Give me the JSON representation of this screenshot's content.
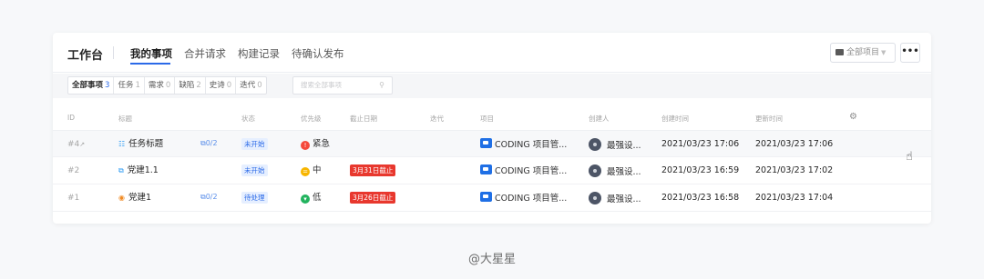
{
  "header": {
    "title": "工作台",
    "tabs": [
      {
        "label": "我的事项",
        "active": true
      },
      {
        "label": "合并请求",
        "active": false
      },
      {
        "label": "构建记录",
        "active": false
      },
      {
        "label": "待确认发布",
        "active": false
      }
    ],
    "project_select": "全部项目",
    "more": "•••"
  },
  "filters": [
    {
      "label": "全部事项",
      "count": "3",
      "active": true
    },
    {
      "label": "任务",
      "count": "1"
    },
    {
      "label": "需求",
      "count": "0"
    },
    {
      "label": "缺陷",
      "count": "2"
    },
    {
      "label": "史诗",
      "count": "0"
    },
    {
      "label": "迭代",
      "count": "0"
    }
  ],
  "search": {
    "placeholder": "搜索全部事项"
  },
  "columns": [
    "ID",
    "标题",
    "状态",
    "优先级",
    "截止日期",
    "迭代",
    "项目",
    "创建人",
    "创建时间",
    "更新时间"
  ],
  "rows": [
    {
      "id": "#4",
      "type_icon": "task-icon",
      "title": "任务标题",
      "sub": "0/2",
      "status": "未开始",
      "priority": "紧急",
      "priority_color": "#f5483b",
      "deadline": "",
      "project": "CODING 项目管...",
      "creator": "最强设...",
      "created": "2021/03/23 17:06",
      "updated": "2021/03/23 17:06"
    },
    {
      "id": "#2",
      "type_icon": "requirement-icon",
      "title": "党建1.1",
      "sub": "",
      "status": "未开始",
      "priority": "中",
      "priority_color": "#f7b500",
      "deadline": "3月31日截止",
      "project": "CODING 项目管...",
      "creator": "最强设...",
      "created": "2021/03/23 16:59",
      "updated": "2021/03/23 17:02"
    },
    {
      "id": "#1",
      "type_icon": "defect-icon",
      "title": "党建1",
      "sub": "0/2",
      "status": "待处理",
      "priority": "低",
      "priority_color": "#22b35e",
      "deadline": "3月26日截止",
      "project": "CODING 项目管...",
      "creator": "最强设...",
      "created": "2021/03/23 16:58",
      "updated": "2021/03/23 17:04"
    }
  ],
  "watermark": "@大星星",
  "colors": {
    "accent": "#2b6ae8",
    "deadline": "#e8382e"
  }
}
